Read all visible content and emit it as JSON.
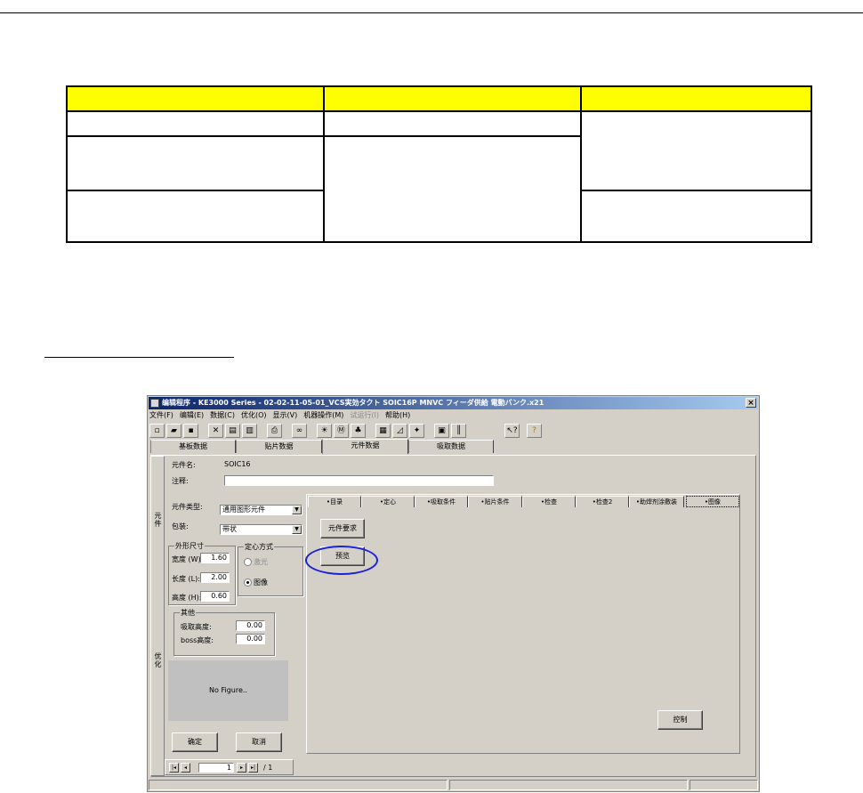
{
  "window": {
    "title": "编辑程序 - KE3000 Series - 02-02-11-05-01_VCS実効タクト SOIC16P MNVC フィーダ供給 電動バンク.x21",
    "close": "×"
  },
  "menu": [
    {
      "label": "文件(F)",
      "enabled": true
    },
    {
      "label": "编辑(E)",
      "enabled": true
    },
    {
      "label": "数据(C)",
      "enabled": true
    },
    {
      "label": "优化(O)",
      "enabled": true
    },
    {
      "label": "显示(V)",
      "enabled": true
    },
    {
      "label": "机器操作(M)",
      "enabled": true
    },
    {
      "label": "试运行(I)",
      "enabled": false
    },
    {
      "label": "帮助(H)",
      "enabled": true
    }
  ],
  "toolbar": {
    "icons": [
      "new-icon",
      "open-icon",
      "save-icon",
      "cut-icon",
      "copy-icon",
      "paste-icon",
      "print-icon",
      "glasses-icon",
      "bulb-icon",
      "feeder-icon",
      "components-icon",
      "list-icon",
      "chart-icon",
      "gear-icon",
      "board-icon",
      "ruler-icon",
      "help-pointer-icon",
      "help-icon"
    ],
    "glyphs": [
      "▫",
      "▰",
      "▪",
      "✕",
      "▤",
      "▥",
      "⎙",
      "∞",
      "☀",
      "Ⓜ",
      "♣",
      "▦",
      "◿",
      "✦",
      "▣",
      "║",
      "↖?",
      "?"
    ]
  },
  "top_tabs": [
    "基板数据",
    "贴片数据",
    "元件数据",
    "吸取数据"
  ],
  "active_top_tab": 2,
  "sidebar": {
    "tab1": "元件",
    "tab2": "优化"
  },
  "form": {
    "part_name_label": "元件名:",
    "part_name_value": "SOIC16",
    "comment_label": "注释:",
    "comment_value": "",
    "part_type_label": "元件类型:",
    "part_type_value": "通用图形元件",
    "package_label": "包装:",
    "package_value": "带状"
  },
  "dimensions": {
    "title": "外形尺寸",
    "width_label": "宽度 (W):",
    "width_value": "1.60",
    "length_label": "长度 (L):",
    "length_value": "2.00",
    "height_label": "高度 (H):",
    "height_value": "0.60"
  },
  "centering": {
    "title": "定心方式",
    "option1": "激光",
    "option2": "图像",
    "selected": 2
  },
  "other": {
    "title": "其他",
    "pickup_label": "吸取高度:",
    "pickup_value": "0.00",
    "boss_label": "boss高度:",
    "boss_value": "0.00"
  },
  "figure_placeholder": "No Figure..",
  "buttons": {
    "ok": "确定",
    "cancel": "取消",
    "control": "控制",
    "element_request": "元件要求",
    "preview": "预览"
  },
  "inner_tabs": [
    "•目录",
    "•定心",
    "•吸取条件",
    "•贴片条件",
    "•检查",
    "•检查2",
    "•助焊剂涂敷装",
    "•图像"
  ],
  "active_inner_tab": 7,
  "pager": {
    "current": "1",
    "total": "/ 1"
  },
  "colors": {
    "highlight_ellipse": "#1e22d6",
    "table_header": "#ffff00",
    "titlebar": "#0a246a"
  }
}
